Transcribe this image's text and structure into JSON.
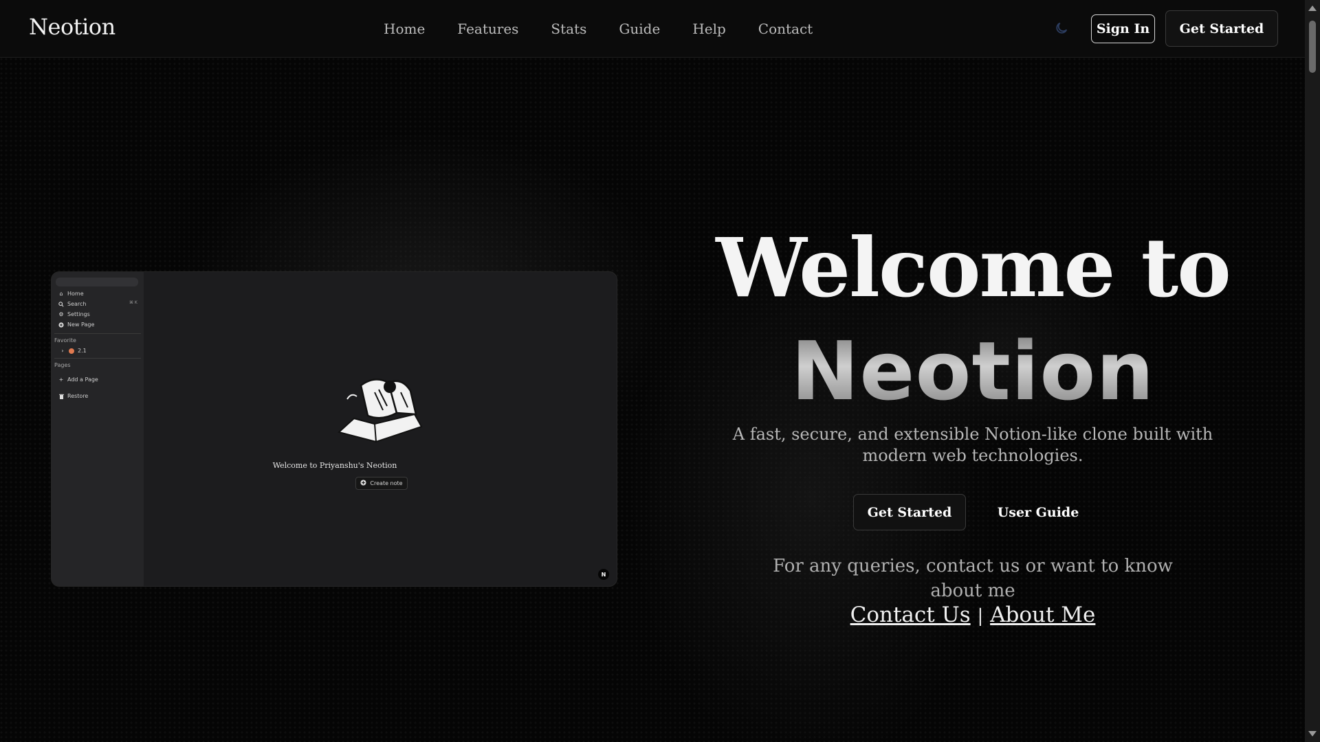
{
  "nav": {
    "brand": "Neotion",
    "links": [
      "Home",
      "Features",
      "Stats",
      "Guide",
      "Help",
      "Contact"
    ],
    "theme_icon": "moon-icon",
    "sign_in": "Sign In",
    "get_started": "Get Started"
  },
  "preview": {
    "sidebar": {
      "items": [
        {
          "label": "Home",
          "icon": "home-icon"
        },
        {
          "label": "Search",
          "icon": "search-icon",
          "shortcut": "⌘ K"
        },
        {
          "label": "Settings",
          "icon": "gear-icon"
        },
        {
          "label": "New Page",
          "icon": "plus-circle-icon"
        }
      ],
      "favorite_heading": "Favorite",
      "favorite_item": "2.1",
      "pages_heading": "Pages",
      "add_page": "Add a Page",
      "restore": "Restore"
    },
    "welcome": "Welcome to Priyanshu's Neotion",
    "create_note": "Create note",
    "badge": "N"
  },
  "hero": {
    "title_line1": "Welcome to",
    "title_line2": "Neotion",
    "subtitle": "A fast, secure, and extensible Notion-like clone built with modern web technologies.",
    "primary_button": "Get Started",
    "secondary_button": "User Guide",
    "query_text": "For any queries, contact us or want to know about me",
    "contact_link": "Contact Us",
    "separator": "|",
    "about_link": "About Me"
  },
  "colors": {
    "background": "#050505",
    "text": "#f4f4f4",
    "muted": "#b8b8b8"
  }
}
